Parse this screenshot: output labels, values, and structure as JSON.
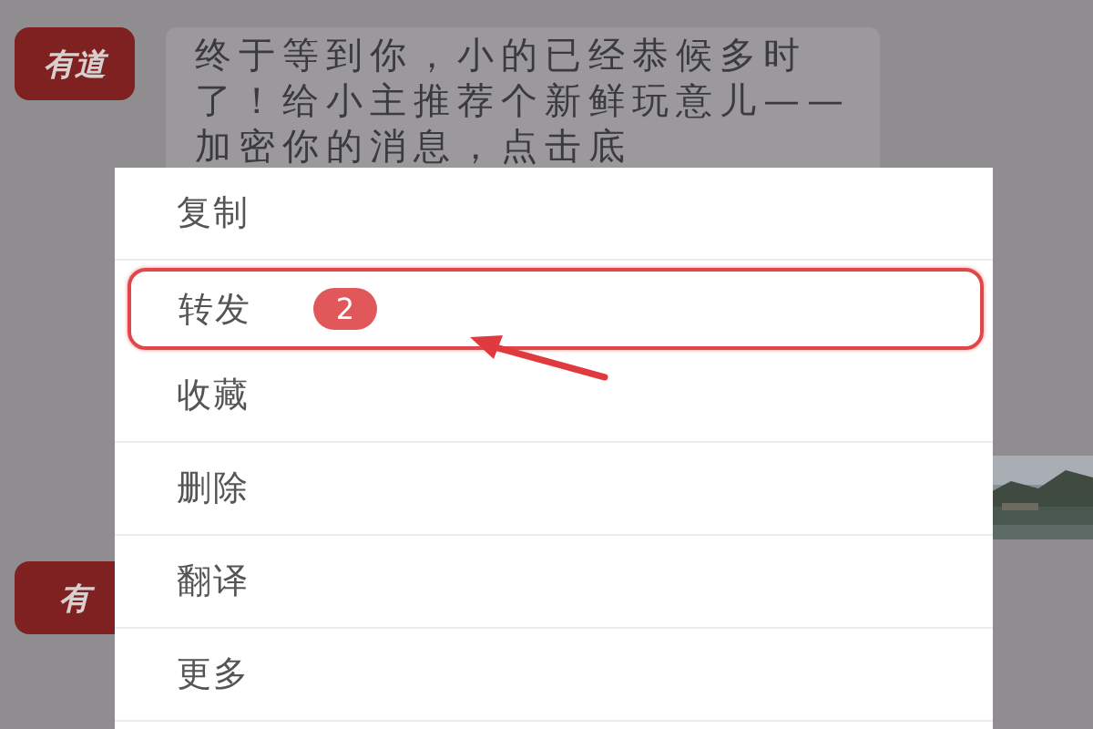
{
  "messages": [
    {
      "avatar": "有道",
      "text": "终于等到你，小的已经恭候多时了！给小主推荐个新鲜玩意儿——加密你的消息，点击底"
    },
    {
      "avatar": "有",
      "kind": "picture"
    }
  ],
  "menu": {
    "items": [
      {
        "label": "复制",
        "selected": false
      },
      {
        "label": "转发",
        "selected": true,
        "badge": "2"
      },
      {
        "label": "收藏",
        "selected": false
      },
      {
        "label": "删除",
        "selected": false
      },
      {
        "label": "翻译",
        "selected": false
      },
      {
        "label": "更多",
        "selected": false
      }
    ]
  }
}
